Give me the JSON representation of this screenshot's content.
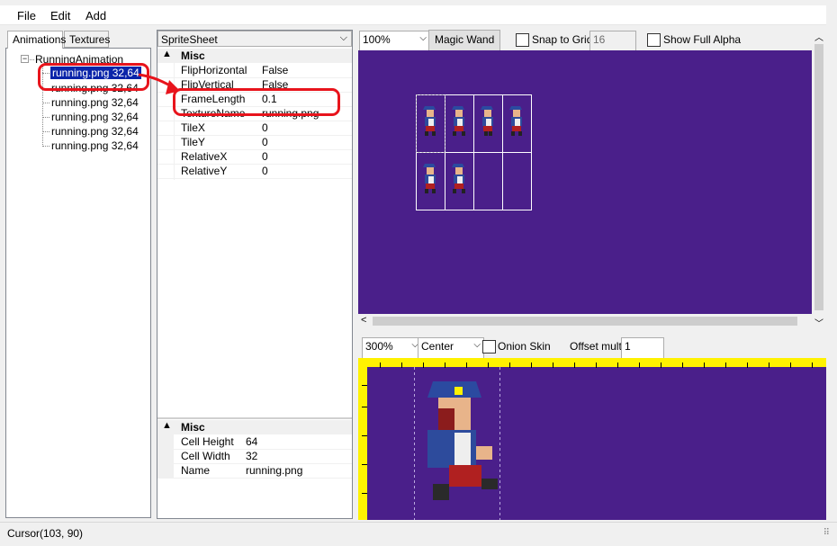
{
  "menu": {
    "file": "File",
    "edit": "Edit",
    "add": "Add"
  },
  "left_tabs": {
    "animations": "Animations",
    "textures": "Textures"
  },
  "tree": {
    "root": "RunningAnimation",
    "items": [
      "running.png 32,64",
      "running.png 32,64",
      "running.png 32,64",
      "running.png 32,64",
      "running.png 32,64",
      "running.png 32,64"
    ]
  },
  "property_grid": {
    "object": "SpriteSheet",
    "category": "Misc",
    "rows": [
      {
        "name": "FlipHorizontal",
        "value": "False"
      },
      {
        "name": "FlipVertical",
        "value": "False"
      },
      {
        "name": "FrameLength",
        "value": "0.1"
      },
      {
        "name": "TextureName",
        "value": "running.png"
      },
      {
        "name": "TileX",
        "value": "0"
      },
      {
        "name": "TileY",
        "value": "0"
      },
      {
        "name": "RelativeX",
        "value": "0"
      },
      {
        "name": "RelativeY",
        "value": "0"
      }
    ]
  },
  "property_grid2": {
    "category": "Misc",
    "rows": [
      {
        "name": "Cell Height",
        "value": "64"
      },
      {
        "name": "Cell Width",
        "value": "32"
      },
      {
        "name": "Name",
        "value": "running.png"
      }
    ]
  },
  "top_toolbar": {
    "zoom": "100%",
    "magic_wand": "Magic Wand",
    "snap_to_grid": "Snap to Grid",
    "grid_size": "16",
    "show_full_alpha": "Show Full Alpha"
  },
  "bottom_toolbar": {
    "zoom": "300%",
    "align": "Center",
    "onion_skin": "Onion Skin",
    "offset_mult_label": "Offset mult:",
    "offset_mult_value": "1"
  },
  "status": {
    "cursor": "Cursor(103, 90)"
  },
  "colors": {
    "canvas": "#4a1f8a",
    "ruler": "#fff200",
    "highlight": "#e8141c",
    "selection": "#0a24a9"
  }
}
